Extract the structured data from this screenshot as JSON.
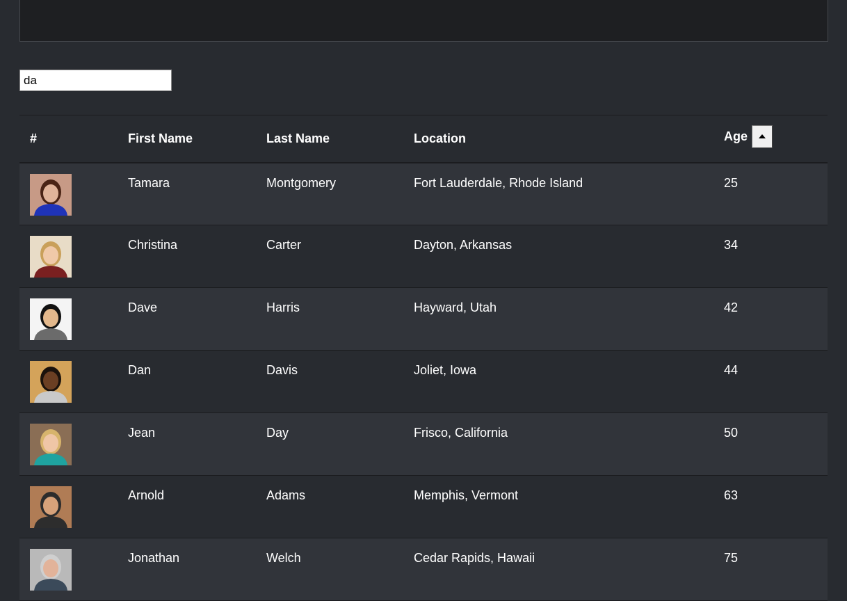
{
  "search": {
    "value": "da"
  },
  "table": {
    "headers": {
      "index": "#",
      "first_name": "First Name",
      "last_name": "Last Name",
      "location": "Location",
      "age": "Age"
    },
    "sort_icon": "caret-up-icon",
    "rows": [
      {
        "first": "Tamara",
        "last": "Montgomery",
        "location": "Fort Lauderdale, Rhode Island",
        "age": "25",
        "avatar_colors": {
          "bg": "#c79a86",
          "hair": "#4a2415",
          "skin": "#e0b49a",
          "shirt": "#1f33b8"
        }
      },
      {
        "first": "Christina",
        "last": "Carter",
        "location": "Dayton, Arkansas",
        "age": "34",
        "avatar_colors": {
          "bg": "#e8dcc7",
          "hair": "#c9a05a",
          "skin": "#f0c9a8",
          "shirt": "#7a2020"
        }
      },
      {
        "first": "Dave",
        "last": "Harris",
        "location": "Hayward, Utah",
        "age": "42",
        "avatar_colors": {
          "bg": "#f4f4f4",
          "hair": "#111111",
          "skin": "#e3b88c",
          "shirt": "#6b6b6b"
        }
      },
      {
        "first": "Dan",
        "last": "Davis",
        "location": "Joliet, Iowa",
        "age": "44",
        "avatar_colors": {
          "bg": "#d4a35a",
          "hair": "#1b120c",
          "skin": "#6b3f23",
          "shirt": "#c9c9c9"
        }
      },
      {
        "first": "Jean",
        "last": "Day",
        "location": "Frisco, California",
        "age": "50",
        "avatar_colors": {
          "bg": "#8a6e55",
          "hair": "#d7b46c",
          "skin": "#efc6a6",
          "shirt": "#1fa3a0"
        }
      },
      {
        "first": "Arnold",
        "last": "Adams",
        "location": "Memphis, Vermont",
        "age": "63",
        "avatar_colors": {
          "bg": "#b07c55",
          "hair": "#2c2c2c",
          "skin": "#d7a27a",
          "shirt": "#2d2d2d"
        }
      },
      {
        "first": "Jonathan",
        "last": "Welch",
        "location": "Cedar Rapids, Hawaii",
        "age": "75",
        "avatar_colors": {
          "bg": "#b9b9b9",
          "hair": "#cfcfcf",
          "skin": "#e2b39a",
          "shirt": "#3b4a5a"
        }
      }
    ]
  }
}
